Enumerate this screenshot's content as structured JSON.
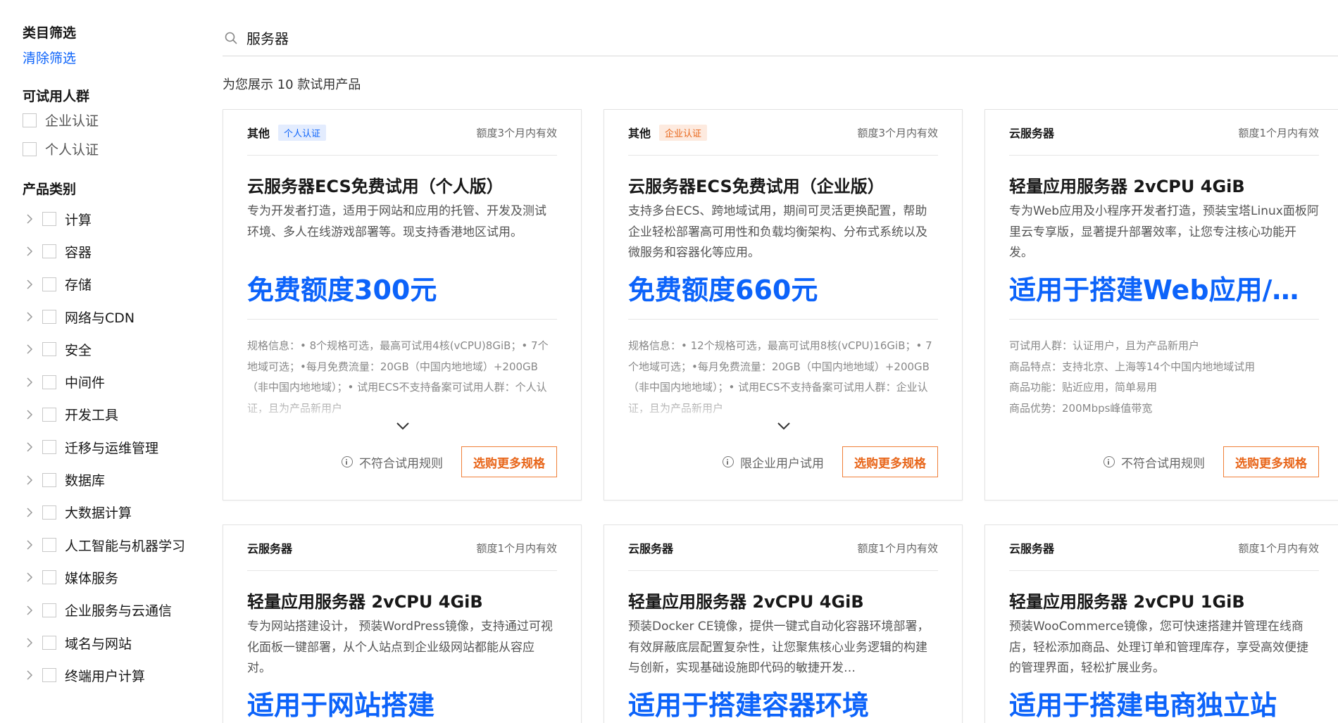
{
  "sidebar": {
    "title": "类目筛选",
    "clear_label": "清除筛选",
    "audience_title": "可试用人群",
    "audience": [
      "企业认证",
      "个人认证"
    ],
    "category_title": "产品类别",
    "categories": [
      "计算",
      "容器",
      "存储",
      "网络与CDN",
      "安全",
      "中间件",
      "开发工具",
      "迁移与运维管理",
      "数据库",
      "大数据计算",
      "人工智能与机器学习",
      "媒体服务",
      "企业服务与云通信",
      "域名与网站",
      "终端用户计算"
    ]
  },
  "search": {
    "value": "服务器"
  },
  "result_count": "为您展示 10 款试用产品",
  "cards": [
    {
      "category": "其他",
      "badge": "个人认证",
      "validity": "额度3个月内有效",
      "title": "云服务器ECS免费试用（个人版）",
      "description": "专为开发者打造，适用于网站和应用的托管、开发及测试环境、多人在线游戏部署等。现支持香港地区试用。",
      "highlight": "免费额度300元",
      "spec": "规格信息：• 8个规格可选，最高可试用4核(vCPU)8GiB；• 7个地域可选；•每月免费流量：20GB（中国内地地域）+200GB（非中国内地地域）；• 试用ECS不支持备案可试用人群：个人认证，且为产品新用户",
      "rule_note": "不符合试用规则",
      "button": "选购更多规格"
    },
    {
      "category": "其他",
      "badge": "企业认证",
      "validity": "额度3个月内有效",
      "title": "云服务器ECS免费试用（企业版）",
      "description": "支持多台ECS、跨地域试用，期间可灵活更换配置，帮助企业轻松部署高可用性和负载均衡架构、分布式系统以及微服务和容器化等应用。",
      "highlight": "免费额度660元",
      "spec": "规格信息：• 12个规格可选，最高可试用8核(vCPU)16GiB；• 7个地域可选；•每月免费流量：20GB（中国内地地域）+200GB（非中国内地地域）；• 试用ECS不支持备案可试用人群：企业认证，且为产品新用户",
      "rule_note": "限企业用户试用",
      "button": "选购更多规格"
    },
    {
      "category": "云服务器",
      "validity": "额度1个月内有效",
      "title": "轻量应用服务器 2vCPU 4GiB",
      "description": "专为Web应用及小程序开发者打造，预装宝塔Linux面板阿里云专享版，显著提升部署效率，让您专注核心功能开发。",
      "highlight": "适用于搭建Web应用/小程序",
      "spec_lines": [
        "可试用人群：认证用户，且为产品新用户",
        "商品特点：支持北京、上海等14个中国内地地域试用",
        "商品功能：贴近应用，简单易用",
        "商品优势：200Mbps峰值带宽"
      ],
      "rule_note": "不符合试用规则",
      "button": "选购更多规格"
    },
    {
      "category": "云服务器",
      "validity": "额度1个月内有效",
      "title": "轻量应用服务器 2vCPU 4GiB",
      "description": "专为网站搭建设计， 预装WordPress镜像，支持通过可视化面板一键部署，从个人站点到企业级网站都能从容应对。",
      "highlight": "适用于网站搭建"
    },
    {
      "category": "云服务器",
      "validity": "额度1个月内有效",
      "title": "轻量应用服务器 2vCPU 4GiB",
      "description": "预装Docker CE镜像，提供一键式自动化容器环境部署，有效屏蔽底层配置复杂性，让您聚焦核心业务逻辑的构建与创新，实现基础设施即代码的敏捷开发…",
      "highlight": "适用于搭建容器环境"
    },
    {
      "category": "云服务器",
      "validity": "额度1个月内有效",
      "title": "轻量应用服务器 2vCPU 1GiB",
      "description": "预装WooCommerce镜像，您可快速搭建并管理在线商店，轻松添加商品、处理订单和管理库存，享受高效便捷的管理界面，轻松扩展业务。",
      "highlight": "适用于搭建电商独立站"
    }
  ]
}
